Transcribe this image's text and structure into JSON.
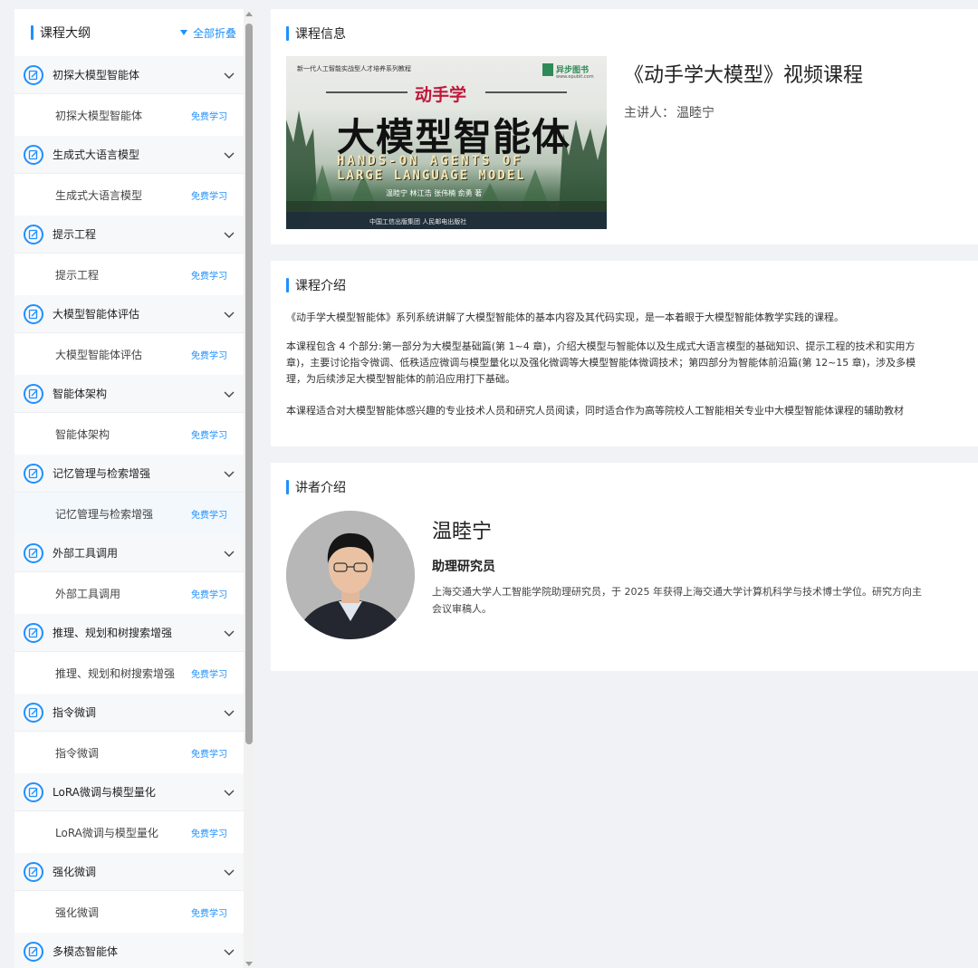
{
  "sidebar": {
    "title": "课程大纲",
    "collapse_all": "全部折叠",
    "chapters": [
      {
        "title": "初探大模型智能体",
        "lesson": "初探大模型智能体",
        "badge": "免费学习"
      },
      {
        "title": "生成式大语言模型",
        "lesson": "生成式大语言模型",
        "badge": "免费学习"
      },
      {
        "title": "提示工程",
        "lesson": "提示工程",
        "badge": "免费学习"
      },
      {
        "title": "大模型智能体评估",
        "lesson": "大模型智能体评估",
        "badge": "免费学习"
      },
      {
        "title": "智能体架构",
        "lesson": "智能体架构",
        "badge": "免费学习"
      },
      {
        "title": "记忆管理与检索增强",
        "lesson": "记忆管理与检索增强",
        "badge": "免费学习"
      },
      {
        "title": "外部工具调用",
        "lesson": "外部工具调用",
        "badge": "免费学习"
      },
      {
        "title": "推理、规划和树搜索增强",
        "lesson": "推理、规划和树搜索增强",
        "badge": "免费学习"
      },
      {
        "title": "指令微调",
        "lesson": "指令微调",
        "badge": "免费学习"
      },
      {
        "title": "LoRA微调与模型量化",
        "lesson": "LoRA微调与模型量化",
        "badge": "免费学习"
      },
      {
        "title": "强化微调",
        "lesson": "强化微调",
        "badge": "免费学习"
      },
      {
        "title": "多模态智能体",
        "lesson": "",
        "badge": ""
      }
    ]
  },
  "course_info": {
    "section_title": "课程信息",
    "course_title": "《动手学大模型》视频课程",
    "lecturer_label": "主讲人：",
    "lecturer_name": "温睦宁",
    "cover": {
      "series": "新一代人工智能实战型人才培养系列教程",
      "publisher": "异步图书",
      "publisher_url": "www.epubit.com",
      "kicker": "动手学",
      "main_title": "大模型智能体",
      "english_line1": "HANDS-ON AGENTS OF",
      "english_line2": "LARGE LANGUAGE MODEL",
      "authors": "温睦宁 林江浩 张伟楠 俞勇 著",
      "press": "中国工信出版集团  人民邮电出版社"
    }
  },
  "course_intro": {
    "section_title": "课程介绍",
    "p1": "《动手学大模型智能体》系列系统讲解了大模型智能体的基本内容及其代码实现，是一本着眼于大模型智能体教学实践的课程。",
    "p2": "本课程包含 4 个部分:第一部分为大模型基础篇(第 1~4 章)，介绍大模型与智能体以及生成式大语言模型的基础知识、提示工程的技术和实用方",
    "p2_line2": "章)，主要讨论指令微调、低秩适应微调与模型量化以及强化微调等大模型智能体微调技术；第四部分为智能体前沿篇(第 12~15 章)，涉及多模",
    "p2_line3": "理，为后续涉足大模型智能体的前沿应用打下基础。",
    "p3": "本课程适合对大模型智能体感兴趣的专业技术人员和研究人员阅读，同时适合作为高等院校人工智能相关专业中大模型智能体课程的辅助教材"
  },
  "speaker": {
    "section_title": "讲者介绍",
    "name": "温睦宁",
    "title": "助理研究员",
    "bio_line1": "上海交通大学人工智能学院助理研究员，于 2025 年获得上海交通大学计算机科学与技术博士学位。研究方向主",
    "bio_line2": "会议审稿人。"
  },
  "colors": {
    "accent": "#1e90ff",
    "page_bg": "#f0f2f5",
    "chapter_bg": "#f7f8fa",
    "active_lesson_bg": "#f3f8fd"
  }
}
